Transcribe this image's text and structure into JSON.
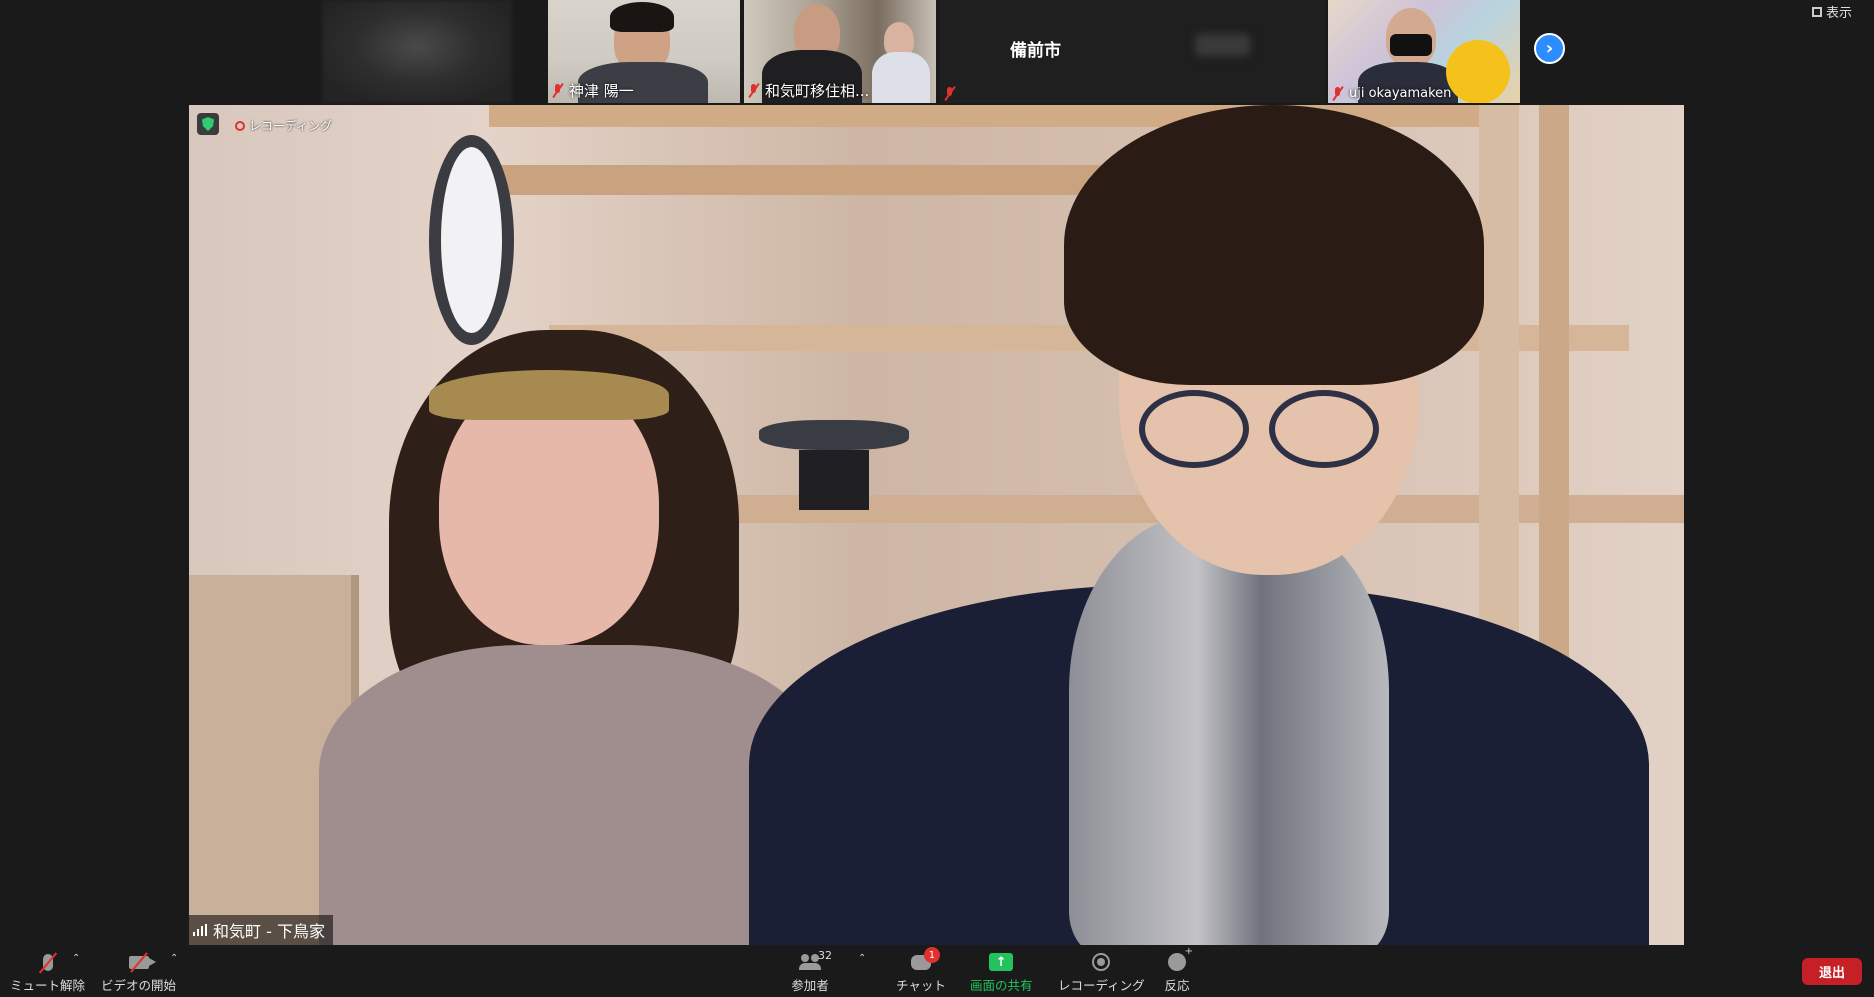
{
  "gallery": {
    "participants": [
      {
        "name": "神津 陽一"
      },
      {
        "name": "和気町移住相..."
      },
      {
        "name": "",
        "label": "備前市"
      },
      {
        "name": "uji okayamaken"
      }
    ],
    "view_label": "表示"
  },
  "main_video": {
    "recording_label": "レコーディング",
    "speaker_name": "和気町 - 下鳥家"
  },
  "toolbar": {
    "unmute_label": "ミュート解除",
    "start_video_label": "ビデオの開始",
    "participants_label": "参加者",
    "participants_count": "32",
    "chat_label": "チャット",
    "chat_badge": "1",
    "share_label": "画面の共有",
    "record_label": "レコーディング",
    "reactions_label": "反応",
    "leave_label": "退出"
  },
  "colors": {
    "accent_blue": "#2d8cff",
    "share_green": "#22c35e",
    "leave_red": "#c52026",
    "muted_red": "#e0312f"
  }
}
